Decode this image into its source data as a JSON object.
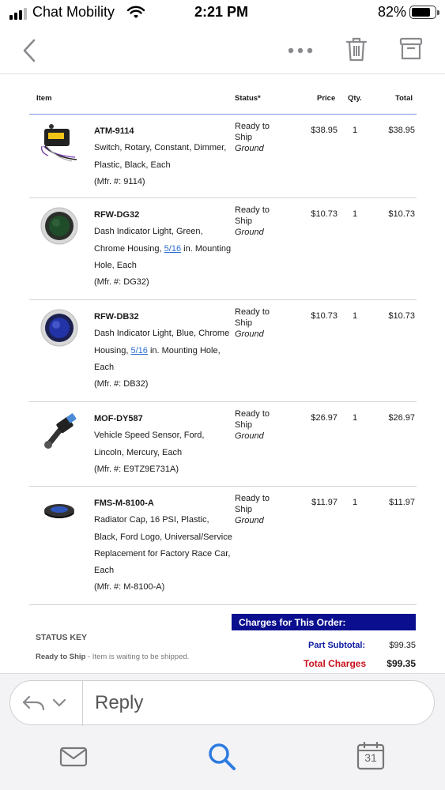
{
  "status_bar": {
    "carrier": "Chat Mobility",
    "time": "2:21 PM",
    "battery_percent": "82%",
    "battery_level": 0.82
  },
  "nav": {
    "icons": [
      "chevron-left-icon",
      "more-icon",
      "trash-icon",
      "archive-icon"
    ]
  },
  "table": {
    "headers": {
      "item": "Item",
      "status": "Status*",
      "price": "Price",
      "qty": "Qty.",
      "total": "Total"
    },
    "rows": [
      {
        "part": "ATM-9114",
        "desc": "Switch, Rotary, Constant, Dimmer, Plastic, Black, Each",
        "desc_link": "",
        "desc_after": "",
        "mfr": "(Mfr. #: 9114)",
        "status_line1": "Ready to",
        "status_line2": "Ship",
        "shipping": "Ground",
        "price": "$38.95",
        "qty": "1",
        "total": "$38.95"
      },
      {
        "part": "RFW-DG32",
        "desc": "Dash Indicator Light, Green, Chrome Housing,",
        "desc_link": "5/16",
        "desc_after": "in. Mounting Hole, Each",
        "mfr": "(Mfr. #: DG32)",
        "status_line1": "Ready to",
        "status_line2": "Ship",
        "shipping": "Ground",
        "price": "$10.73",
        "qty": "1",
        "total": "$10.73"
      },
      {
        "part": "RFW-DB32",
        "desc": "Dash Indicator Light, Blue, Chrome Housing,",
        "desc_link": "5/16",
        "desc_after": "in. Mounting Hole, Each",
        "mfr": "(Mfr. #: DB32)",
        "status_line1": "Ready to",
        "status_line2": "Ship",
        "shipping": "Ground",
        "price": "$10.73",
        "qty": "1",
        "total": "$10.73"
      },
      {
        "part": "MOF-DY587",
        "desc": "Vehicle Speed Sensor, Ford, Lincoln, Mercury, Each",
        "desc_link": "",
        "desc_after": "",
        "mfr": "(Mfr. #: E9TZ9E731A)",
        "status_line1": "Ready to",
        "status_line2": "Ship",
        "shipping": "Ground",
        "price": "$26.97",
        "qty": "1",
        "total": "$26.97"
      },
      {
        "part": "FMS-M-8100-A",
        "desc": "Radiator Cap, 16 PSI, Plastic, Black, Ford Logo, Universal/Service Replacement for Factory Race Car, Each",
        "desc_link": "",
        "desc_after": "",
        "mfr": "(Mfr. #: M-8100-A)",
        "status_line1": "Ready to",
        "status_line2": "Ship",
        "shipping": "Ground",
        "price": "$11.97",
        "qty": "1",
        "total": "$11.97"
      }
    ]
  },
  "charges": {
    "heading": "Charges for This Order:",
    "subtotal_label": "Part Subtotal:",
    "subtotal": "$99.35",
    "total_label": "Total Charges",
    "total": "$99.35"
  },
  "status_key": {
    "title": "STATUS KEY",
    "term": "Ready to Ship",
    "definition": "- Item is waiting to be shipped."
  },
  "reply": {
    "label": "Reply"
  },
  "tab_bar": {
    "calendar_day": "31"
  },
  "colors": {
    "charges_header": "#0b0f8f",
    "subtotal_label": "#0b1aa0",
    "total_label": "#c8121e",
    "link": "#2c6fd1",
    "tab_active": "#2d7be0"
  }
}
